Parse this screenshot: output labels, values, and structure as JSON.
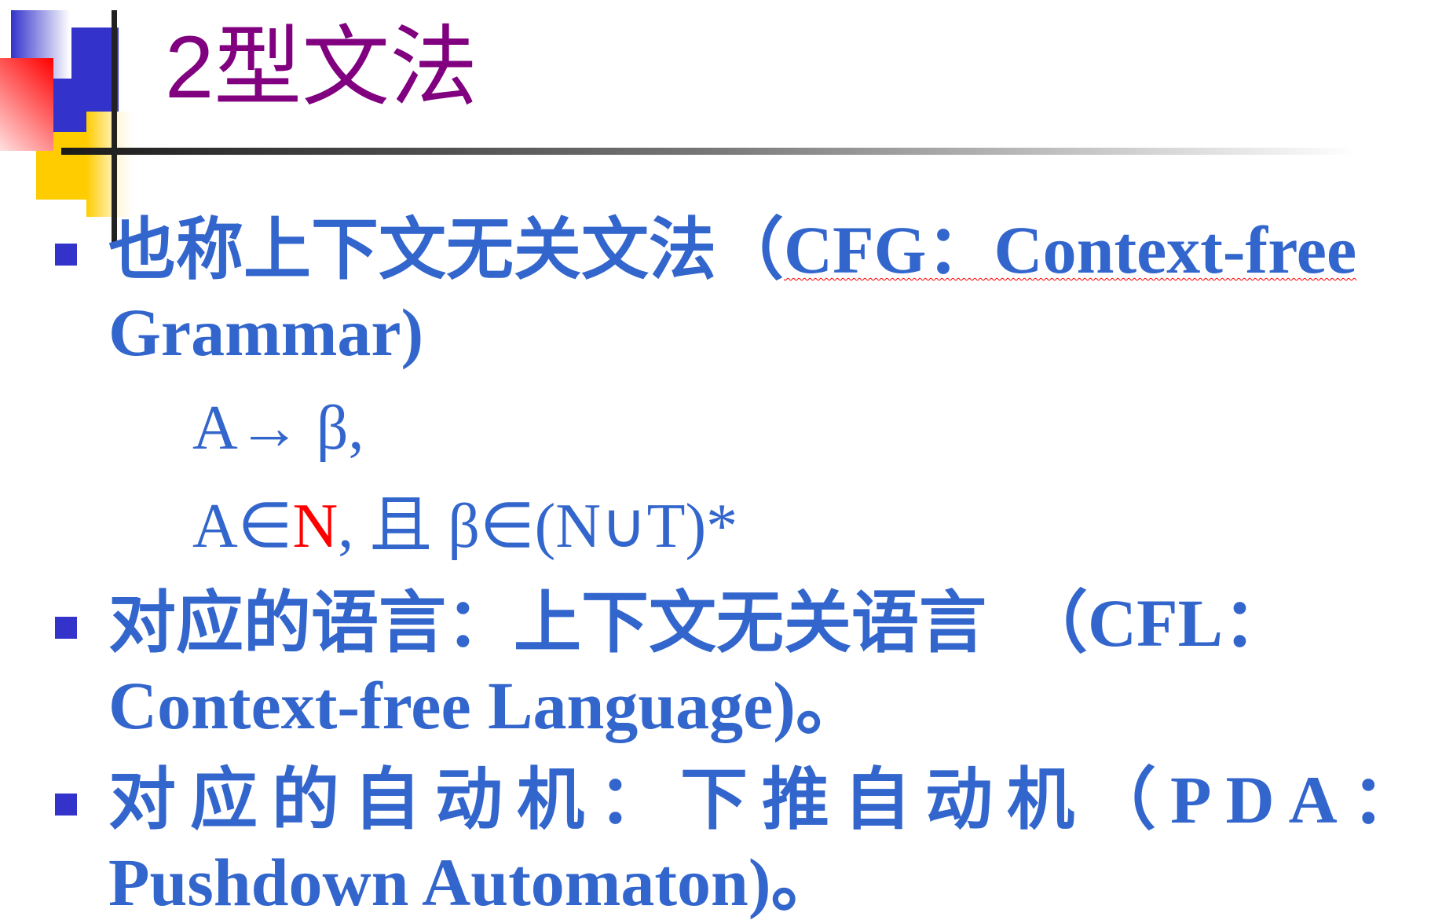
{
  "title": "2型文法",
  "b1": {
    "zh": "也称上下文无关文法（",
    "en": "CFG：Context-free",
    "line2": "Grammar)"
  },
  "formula1": "A→ β,",
  "formula2": {
    "a": "A∈",
    "n": "N",
    "rest": ", 且 β∈(N∪T)*"
  },
  "b2": {
    "line1": "对应的语言：上下文无关语言　（CFL：",
    "line2": "Context-free Language)。"
  },
  "b3": {
    "line1": "对应的自动机：下推自动机（PDA：",
    "line2": "Pushdown Automaton)。"
  },
  "colors": {
    "text": "#3366cc",
    "title": "#800080",
    "bullet": "#3333cc",
    "highlight": "#ff0000"
  }
}
